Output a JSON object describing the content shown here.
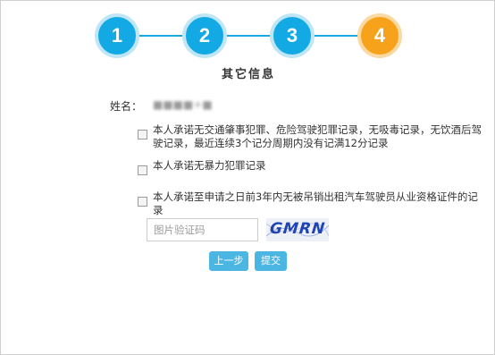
{
  "stepper": {
    "steps": [
      {
        "number": "1",
        "state": "completed",
        "color": "#13a9e5"
      },
      {
        "number": "2",
        "state": "completed",
        "color": "#13a9e5"
      },
      {
        "number": "3",
        "state": "completed",
        "color": "#13a9e5"
      },
      {
        "number": "4",
        "state": "current",
        "color": "#f7a21b"
      }
    ],
    "line_color": "#1aa8e0"
  },
  "section": {
    "title": "其它信息"
  },
  "applicant": {
    "name_label": "姓名：",
    "name_value": "■■■■+■"
  },
  "declarations": [
    {
      "label": "本人承诺无交通肇事犯罪、危险驾驶犯罪记录，无吸毒记录，无饮酒后驾驶记录，最近连续3个记分周期内没有记满12分记录",
      "checked": false
    },
    {
      "label": "本人承诺无暴力犯罪记录",
      "checked": false
    },
    {
      "label": "本人承诺至申请之日前3年内无被吊销出租汽车驾驶员从业资格证件的记录",
      "checked": false
    }
  ],
  "captcha": {
    "placeholder": "图片验证码",
    "value": "",
    "image_text": "GMRN"
  },
  "buttons": {
    "prev_label": "上一步",
    "submit_label": "提交",
    "color": "#4cb6e3"
  }
}
